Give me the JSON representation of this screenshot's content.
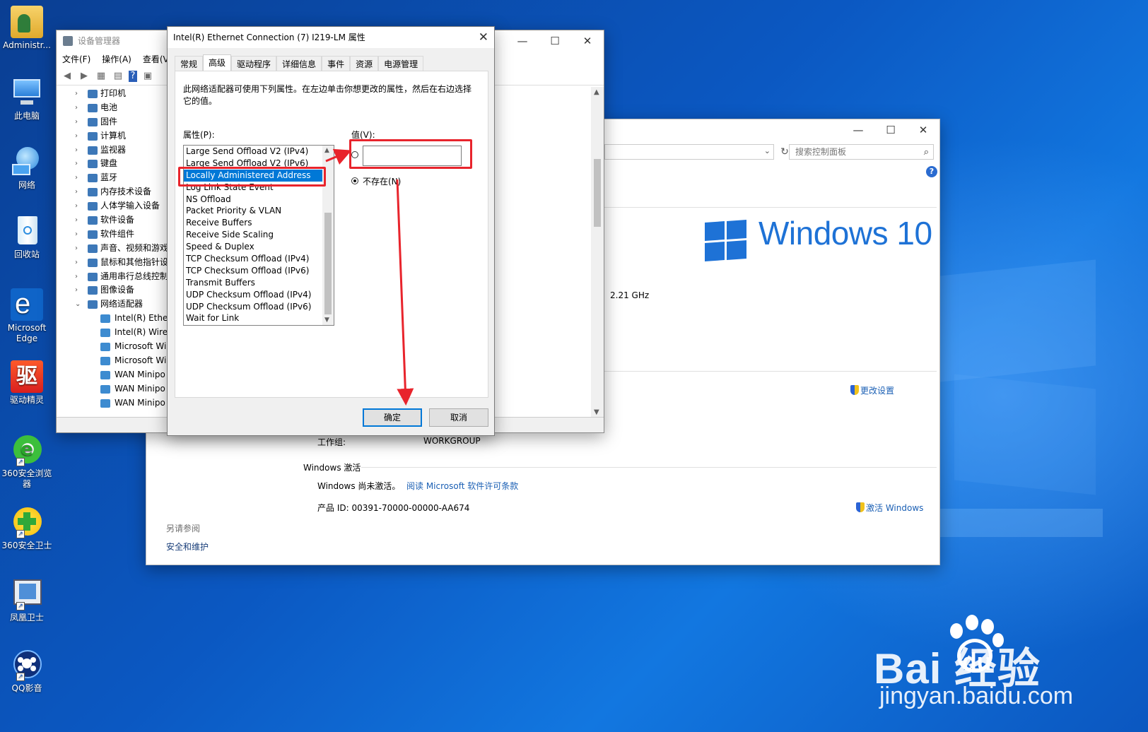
{
  "desktop": {
    "icons": [
      {
        "label": "Administr...",
        "icon": "user-folder-icon"
      },
      {
        "label": "此电脑",
        "icon": "computer-icon"
      },
      {
        "label": "网络",
        "icon": "network-globe-icon"
      },
      {
        "label": "回收站",
        "icon": "recycle-bin-icon"
      },
      {
        "label": "Microsoft Edge",
        "icon": "edge-icon"
      },
      {
        "label": "驱动精灵",
        "icon": "driver-genius-icon"
      },
      {
        "label": "360安全浏览器",
        "icon": "360-browser-icon"
      },
      {
        "label": "360安全卫士",
        "icon": "360-safe-icon"
      },
      {
        "label": "凤凰卫士",
        "icon": "phoenix-guard-icon"
      },
      {
        "label": "QQ影音",
        "icon": "qq-player-icon"
      }
    ]
  },
  "device_manager": {
    "title": "设备管理器",
    "menu": [
      "文件(F)",
      "操作(A)",
      "查看(V"
    ],
    "tree": [
      {
        "label": "打印机",
        "expanded": false
      },
      {
        "label": "电池",
        "expanded": false
      },
      {
        "label": "固件",
        "expanded": false
      },
      {
        "label": "计算机",
        "expanded": false
      },
      {
        "label": "监视器",
        "expanded": false
      },
      {
        "label": "键盘",
        "expanded": false
      },
      {
        "label": "蓝牙",
        "expanded": false
      },
      {
        "label": "内存技术设备",
        "expanded": false
      },
      {
        "label": "人体学输入设备",
        "expanded": false
      },
      {
        "label": "软件设备",
        "expanded": false
      },
      {
        "label": "软件组件",
        "expanded": false
      },
      {
        "label": "声音、视频和游戏",
        "expanded": false
      },
      {
        "label": "鼠标和其他指针设",
        "expanded": false
      },
      {
        "label": "通用串行总线控制",
        "expanded": false
      },
      {
        "label": "图像设备",
        "expanded": false
      },
      {
        "label": "网络适配器",
        "expanded": true
      }
    ],
    "adapters": [
      "Intel(R) Ether",
      "Intel(R) Wirel",
      "Microsoft Wi",
      "Microsoft Wi",
      "WAN Minipo",
      "WAN Minipo",
      "WAN Minipo"
    ]
  },
  "system_window": {
    "search_placeholder": "搜索控制面板",
    "brand": "Windows 10",
    "cpu_speed": "2.21 GHz",
    "change_settings": "更改设置",
    "workgroup_label": "工作组:",
    "workgroup_value": "WORKGROUP",
    "activation_heading": "Windows 激活",
    "activation_status": "Windows 尚未激活。",
    "license_link": "阅读 Microsoft 软件许可条款",
    "product_id": "产品 ID: 00391-70000-00000-AA674",
    "activate_link": "激活 Windows",
    "see_also": "另请参阅",
    "security_link": "安全和维护"
  },
  "properties_dialog": {
    "title": "Intel(R) Ethernet Connection (7) I219-LM 属性",
    "tabs": [
      "常规",
      "高级",
      "驱动程序",
      "详细信息",
      "事件",
      "资源",
      "电源管理"
    ],
    "active_tab": "高级",
    "description": "此网络适配器可使用下列属性。在左边单击你想更改的属性，然后在右边选择它的值。",
    "property_label": "属性(P):",
    "value_label": "值(V):",
    "properties": [
      "Large Send Offload V2 (IPv4)",
      "Large Send Offload V2 (IPv6)",
      "Locally Administered Address",
      "Log Link State Event",
      "NS Offload",
      "Packet Priority & VLAN",
      "Receive Buffers",
      "Receive Side Scaling",
      "Speed & Duplex",
      "TCP Checksum Offload (IPv4)",
      "TCP Checksum Offload (IPv6)",
      "Transmit Buffers",
      "UDP Checksum Offload (IPv4)",
      "UDP Checksum Offload (IPv6)",
      "Wait for Link"
    ],
    "selected_property": "Locally Administered Address",
    "value_input": "",
    "not_present": "不存在(N)",
    "ok": "确定",
    "cancel": "取消"
  },
  "watermark": {
    "brand": "Bai  经验",
    "du": "du",
    "url": "jingyan.baidu.com"
  },
  "colors": {
    "annotation_red": "#e8242c",
    "selection_blue": "#0078d7",
    "win10_blue": "#1e72d6"
  }
}
